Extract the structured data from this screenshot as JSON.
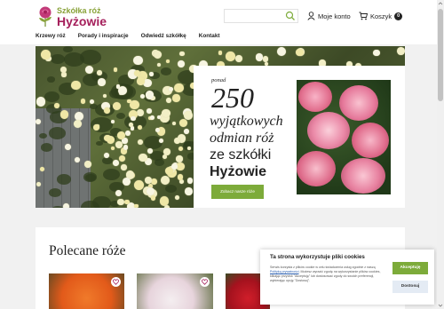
{
  "header": {
    "logo_line1": "Szkółka róż",
    "logo_line2": "Hyżowie",
    "search_placeholder": "",
    "account_label": "Moje konto",
    "cart_label": "Koszyk",
    "cart_count": "0"
  },
  "nav": {
    "items": [
      "Krzewy róż",
      "Porady i inspiracje",
      "Odwiedź szkółkę",
      "Kontakt"
    ]
  },
  "promo": {
    "pre": "ponad",
    "number": "250",
    "line1": "wyjątkowych",
    "line2": "odmian róż",
    "line3": "ze szkółki",
    "line4": "Hyżowie",
    "button": "Zobacz nasze róże"
  },
  "recommended": {
    "title": "Polecane róże"
  },
  "cookie": {
    "title": "Ta strona wykorzystuje pliki cookies",
    "text_before": "Serwis korzysta z plików cookie w celu świadczenia usług zgodnie z naszą",
    "policy_link": "Polityką prywatności",
    "text_after": ". Możesz wyrazić zgodę na wykorzystanie plików cookies, klikając przycisk \"Akceptuję\" lub dostosować zgody do swoich preferencji, wybierając opcję \"Dostosuj\".",
    "accept_label": "Akceptuję",
    "customize_label": "Dostosuj"
  },
  "colors": {
    "accent_green": "#7dab3a",
    "brand_pink": "#a51f5b",
    "logo_green": "#8aa33a"
  }
}
